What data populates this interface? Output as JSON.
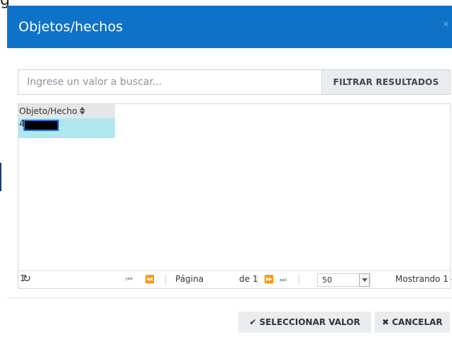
{
  "window": {
    "background_glyph": "g"
  },
  "dialog": {
    "title": "Objetos/hechos",
    "close_glyph": "×",
    "accent_color": "#0e72c7"
  },
  "search": {
    "placeholder": "Ingrese un valor a buscar...",
    "value": "",
    "filter_label": "FILTRAR RESULTADOS"
  },
  "grid": {
    "columns": [
      {
        "label": "Objeto/Hecho",
        "sort_icon": "sort-icon"
      }
    ],
    "rows": [
      {
        "value_prefix": "4",
        "redacted": true,
        "selected": true
      }
    ],
    "selected_row_color": "#b0e8f0"
  },
  "pager": {
    "refresh_icon": "↻",
    "first_icon": "⏮",
    "prev_icon": "⏪",
    "next_icon": "⏩",
    "last_icon": "⏭",
    "page_label": "Página",
    "page_value": "1",
    "of_label": "de 1",
    "page_size": "50",
    "info": "Mostrando 1 -"
  },
  "footer": {
    "select_icon": "✔",
    "select_label": "SELECCIONAR VALOR",
    "cancel_icon": "✖",
    "cancel_label": "CANCELAR"
  }
}
